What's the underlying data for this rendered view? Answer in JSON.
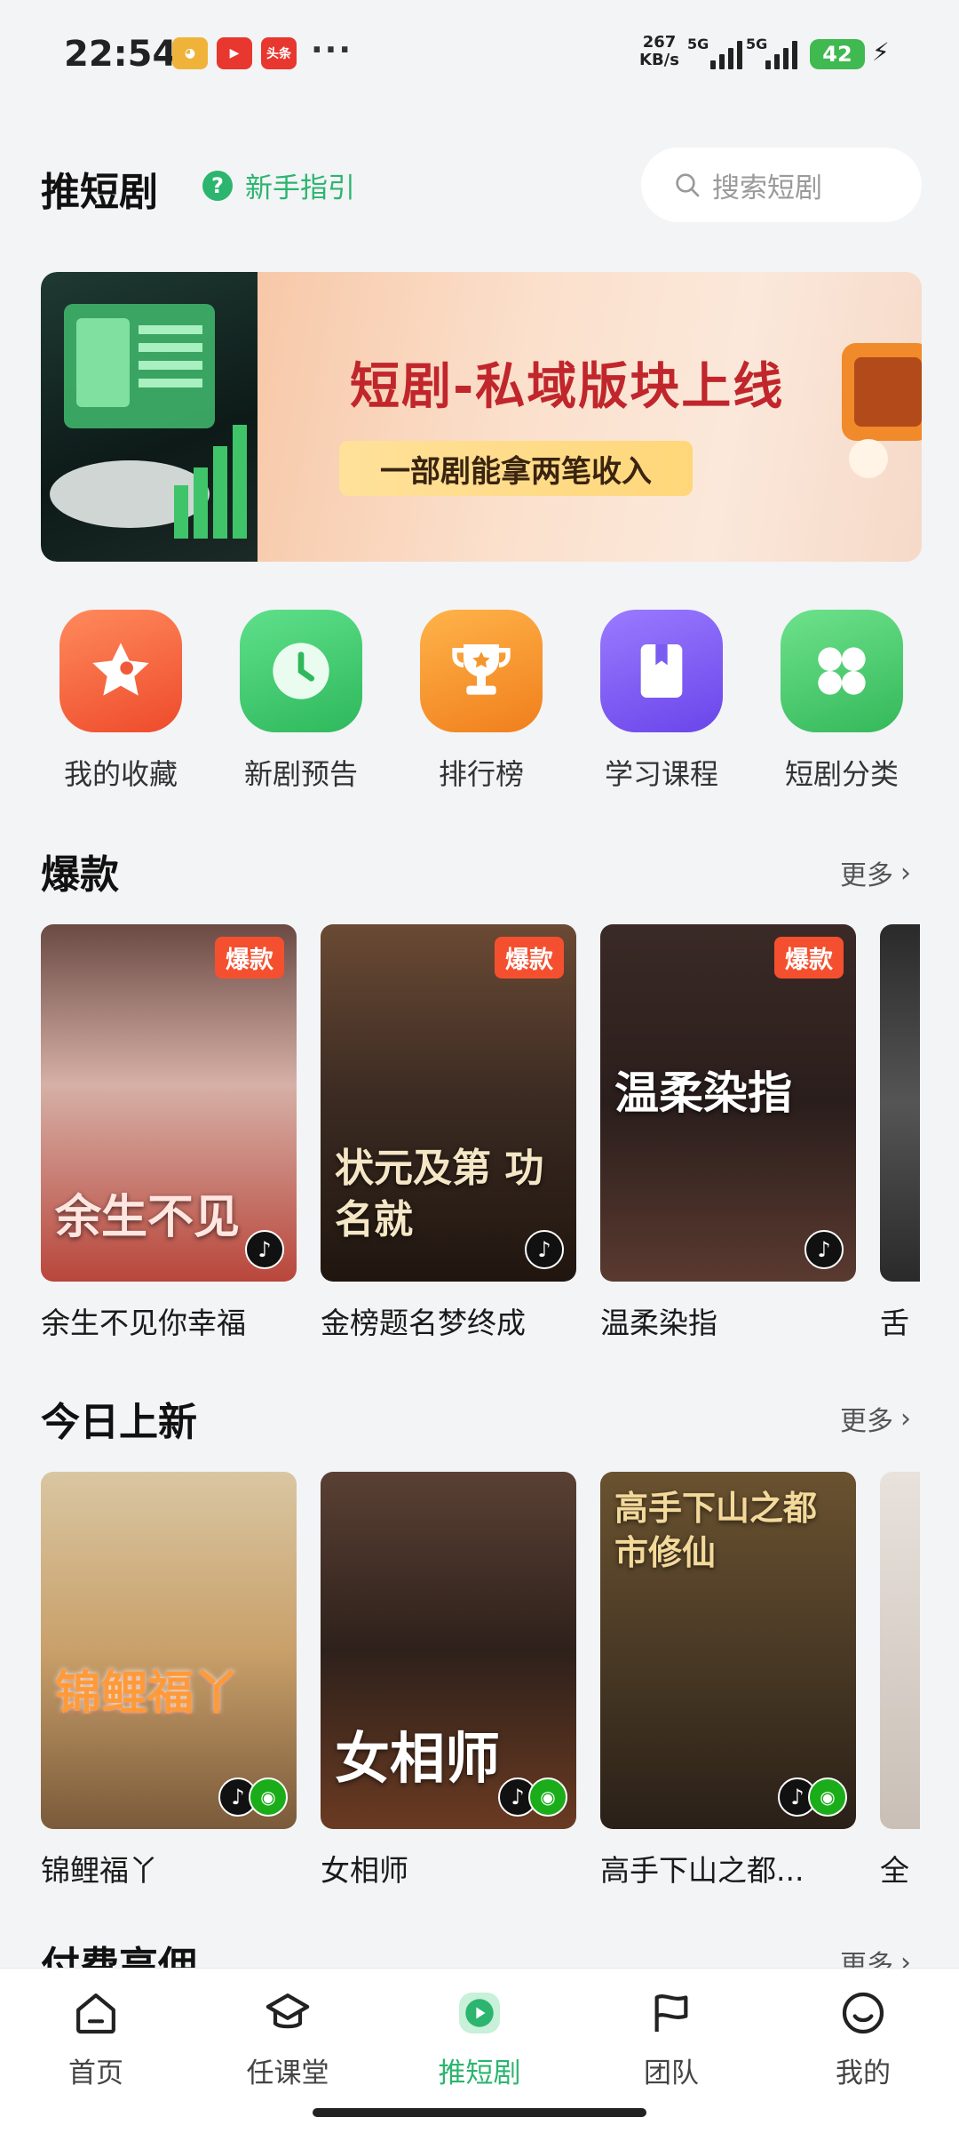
{
  "status": {
    "time": "22:54",
    "apps": [
      {
        "icon": "app-icon-1",
        "color": "#e0a030"
      },
      {
        "icon": "app-icon-2",
        "color": "#e8372f"
      },
      {
        "icon": "toutiao-icon",
        "color": "#e8372f",
        "label": "头条"
      }
    ],
    "more": "···",
    "net_speed": "267",
    "net_unit": "KB/s",
    "sig1": "5G",
    "sig2": "5G",
    "battery": "42"
  },
  "header": {
    "title": "推短剧",
    "guide_label": "新手指引",
    "search_placeholder": "搜索短剧"
  },
  "banner": {
    "title": "短剧-私域版块上线",
    "subtitle": "一部剧能拿两笔收入"
  },
  "quick": [
    {
      "label": "我的收藏",
      "icon": "star-icon",
      "color": "#f05a3a"
    },
    {
      "label": "新剧预告",
      "icon": "clock-icon",
      "color": "#3cc46a"
    },
    {
      "label": "排行榜",
      "icon": "trophy-icon",
      "color": "#f5962c"
    },
    {
      "label": "学习课程",
      "icon": "book-icon",
      "color": "#7b5cf0"
    },
    {
      "label": "短剧分类",
      "icon": "grid-icon",
      "color": "#45c468"
    }
  ],
  "sections": {
    "hot": {
      "title": "爆款",
      "more": "更多",
      "cards": [
        {
          "title": "余生不见你幸福",
          "badge": "爆款",
          "poster_text": "余生不见",
          "bg": "#d8b7b0"
        },
        {
          "title": "金榜题名梦终成",
          "badge": "爆款",
          "poster_text": "状元及第 功名就",
          "bg": "#3a2a22"
        },
        {
          "title": "温柔染指",
          "badge": "爆款",
          "poster_text": "温柔染指",
          "bg": "#2a1e1c"
        },
        {
          "title": "舌",
          "badge": "",
          "poster_text": "",
          "bg": "#3b3b3b"
        }
      ]
    },
    "new": {
      "title": "今日上新",
      "more": "更多",
      "cards": [
        {
          "title": "锦鲤福丫",
          "poster_text": "锦鲤福丫",
          "bg": "#c9b48e"
        },
        {
          "title": "女相师",
          "poster_text": "女相师",
          "bg": "#2e211b"
        },
        {
          "title": "高手下山之都...",
          "poster_text": "高手下山之都市修仙",
          "bg": "#4a3a25"
        },
        {
          "title": "全",
          "poster_text": "",
          "bg": "#d9d2cc"
        }
      ]
    },
    "paid": {
      "title": "付费高佣",
      "more": "更多"
    }
  },
  "nav": [
    {
      "label": "首页",
      "icon": "home-icon"
    },
    {
      "label": "任课堂",
      "icon": "graduation-cap-icon"
    },
    {
      "label": "推短剧",
      "icon": "play-icon",
      "active": true
    },
    {
      "label": "团队",
      "icon": "flag-icon"
    },
    {
      "label": "我的",
      "icon": "smiley-icon"
    }
  ],
  "colors": {
    "accent": "#2bb56f",
    "badge": "#f4502f",
    "banner_title": "#c0262b"
  }
}
